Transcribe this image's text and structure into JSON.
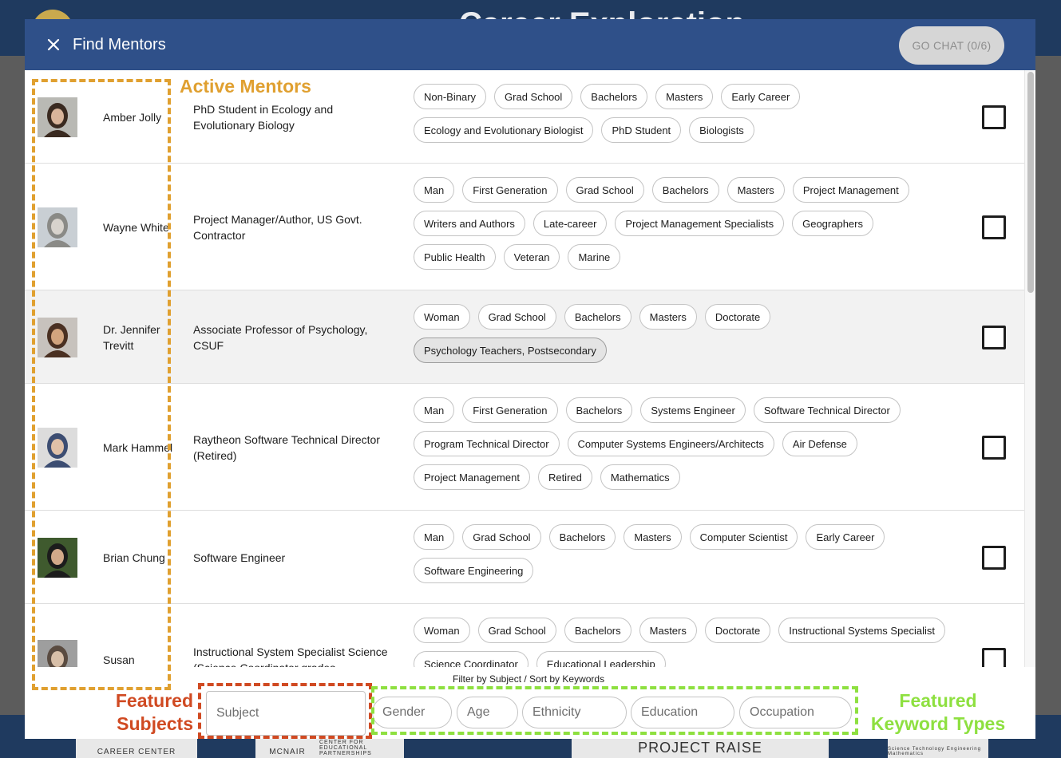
{
  "background": {
    "title": "Career Exploration"
  },
  "modal": {
    "title": "Find Mentors",
    "go_chat_label": "GO CHAT (0/6)"
  },
  "mentors": [
    {
      "name": "Amber Jolly",
      "occupation": "PhD Student in Ecology and Evolutionary Biology",
      "keywords": [
        "Non-Binary",
        "Grad School",
        "Bachelors",
        "Masters",
        "Early Career",
        "Ecology and Evolutionary Biologist",
        "PhD Student",
        "Biologists"
      ],
      "checked": false,
      "highlighted": false
    },
    {
      "name": "Wayne White",
      "occupation": "Project Manager/Author, US Govt. Contractor",
      "keywords": [
        "Man",
        "First Generation",
        "Grad School",
        "Bachelors",
        "Masters",
        "Project Management",
        "Writers and Authors",
        "Late-career",
        "Project Management Specialists",
        "Geographers",
        "Public Health",
        "Veteran",
        "Marine"
      ],
      "checked": false,
      "highlighted": false
    },
    {
      "name": "Dr. Jennifer Trevitt",
      "occupation": "Associate Professor of Psychology, CSUF",
      "keywords": [
        "Woman",
        "Grad School",
        "Bachelors",
        "Masters",
        "Doctorate",
        "Psychology Teachers, Postsecondary"
      ],
      "selected_keyword": "Psychology Teachers, Postsecondary",
      "checked": false,
      "highlighted": true
    },
    {
      "name": "Mark Hammel",
      "occupation": "Raytheon Software Technical Director (Retired)",
      "keywords": [
        "Man",
        "First Generation",
        "Bachelors",
        "Systems Engineer",
        "Software Technical Director",
        "Program Technical Director",
        "Computer Systems Engineers/Architects",
        "Air Defense",
        "Project Management",
        "Retired",
        "Mathematics"
      ],
      "checked": false,
      "highlighted": false
    },
    {
      "name": "Brian Chung",
      "occupation": "Software Engineer",
      "keywords": [
        "Man",
        "Grad School",
        "Bachelors",
        "Masters",
        "Computer Scientist",
        "Early Career",
        "Software Engineering"
      ],
      "checked": false,
      "highlighted": false
    },
    {
      "name": "Susan",
      "occupation": "Instructional System Specialist Science (Science Coordinator grades",
      "keywords": [
        "Woman",
        "Grad School",
        "Bachelors",
        "Masters",
        "Doctorate",
        "Instructional Systems Specialist",
        "Science Coordinator",
        "Educational Leadership"
      ],
      "checked": false,
      "highlighted": false
    }
  ],
  "filter": {
    "caption": "Filter by Subject / Sort by Keywords",
    "subject_placeholder": "Subject",
    "keyword_types": [
      "Gender",
      "Age",
      "Ethnicity",
      "Education",
      "Occupation"
    ]
  },
  "annotations": {
    "active_mentors": "Active Mentors",
    "featured_subjects": [
      "Featured",
      "Subjects"
    ],
    "featured_keyword_types": [
      "Featured",
      "Keyword Types"
    ],
    "orange": "#e0a030",
    "red": "#d04a22",
    "green": "#8ee040"
  },
  "sponsors": [
    "CAREER CENTER",
    "MCNAIR",
    "CENTER FOR EDUCATIONAL PARTNERSHIPS",
    "PROJECT RAISE",
    "Science Technology Engineering Mathematics"
  ],
  "colors": {
    "header": "#2f5089",
    "go_chat_bg": "#d6d6d6"
  }
}
